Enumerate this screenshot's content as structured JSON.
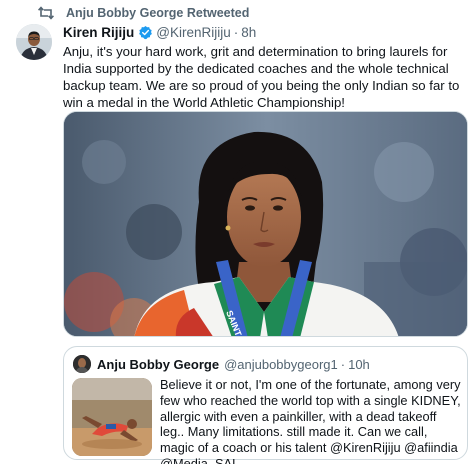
{
  "retweet": {
    "label": "Anju Bobby George Retweeted",
    "icon": "retweet-icon"
  },
  "tweet": {
    "author_name": "Kiren Rijiju",
    "handle": "@KirenRijiju",
    "separator": "·",
    "time": "8h",
    "verified_icon": "verified-badge-icon",
    "text": "Anju, it's your hard work, grit and determination to bring laurels for India supported by the dedicated coaches and the whole technical backup team. We are so proud of you being the only Indian so far to win a medal in the World Athletic Championship!",
    "media_label": "SAINT-DENIS"
  },
  "quoted_tweet": {
    "author_name": "Anju Bobby George",
    "handle": "@anjubobbygeorg1",
    "separator": "·",
    "time": "10h",
    "text": "Believe it or not, I'm one of the fortunate, among very few who reached the world top with a single KIDNEY, allergic with even a  painkiller, with a dead takeoff leg.. Many limitations. still made it. Can we call,  magic of a coach or his talent @KirenRijiju @afiindia @Media_SAI"
  },
  "colors": {
    "text": "#0f1419",
    "secondary": "#536471",
    "verified": "#1d9bf0",
    "border": "#cfd9de"
  }
}
